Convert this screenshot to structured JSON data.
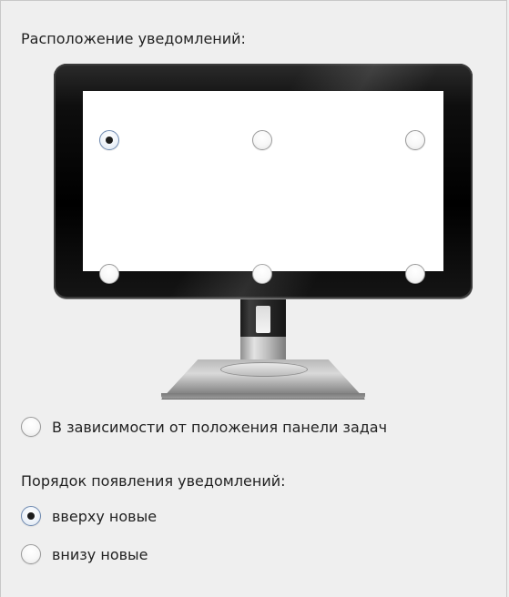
{
  "placement": {
    "heading": "Расположение уведомлений:",
    "positions": [
      {
        "id": "top-left",
        "checked": true
      },
      {
        "id": "top-center",
        "checked": false
      },
      {
        "id": "top-right",
        "checked": false
      },
      {
        "id": "bottom-left",
        "checked": false
      },
      {
        "id": "bottom-center",
        "checked": false
      },
      {
        "id": "bottom-right",
        "checked": false
      }
    ],
    "taskbar_option": {
      "label": "В зависимости от положения панели задач",
      "checked": false
    }
  },
  "order": {
    "heading": "Порядок появления уведомлений:",
    "options": [
      {
        "label": "вверху новые",
        "checked": true
      },
      {
        "label": "внизу новые",
        "checked": false
      }
    ]
  },
  "colors": {
    "background": "#efefef",
    "screen": "#ffffff",
    "monitor_bezel": "#000000",
    "radio_checked_border": "#6f8ab0"
  }
}
